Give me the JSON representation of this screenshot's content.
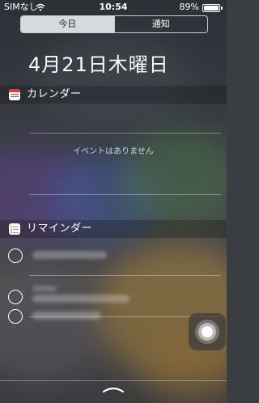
{
  "status_bar": {
    "carrier": "SIMなし",
    "time": "10:54",
    "battery_percent": "89%",
    "battery_level": 0.89,
    "icons": [
      "wifi-icon",
      "battery-icon"
    ]
  },
  "tabs": [
    {
      "label": "今日",
      "selected": true
    },
    {
      "label": "通知",
      "selected": false
    }
  ],
  "date_heading": "4月21日木曜日",
  "calendar": {
    "title": "カレンダー",
    "icon": "calendar-icon",
    "empty_text": "イベントはありません"
  },
  "reminders": {
    "title": "リマインダー",
    "icon": "reminders-icon",
    "items": [
      {
        "text": ""
      },
      {
        "text": ""
      },
      {
        "text": ""
      }
    ]
  },
  "colors": {
    "selected_tab_bg": "#e4e8eb",
    "calendar_icon_accent": "#e53935",
    "reminder_icon_accent": "#f57c00"
  }
}
